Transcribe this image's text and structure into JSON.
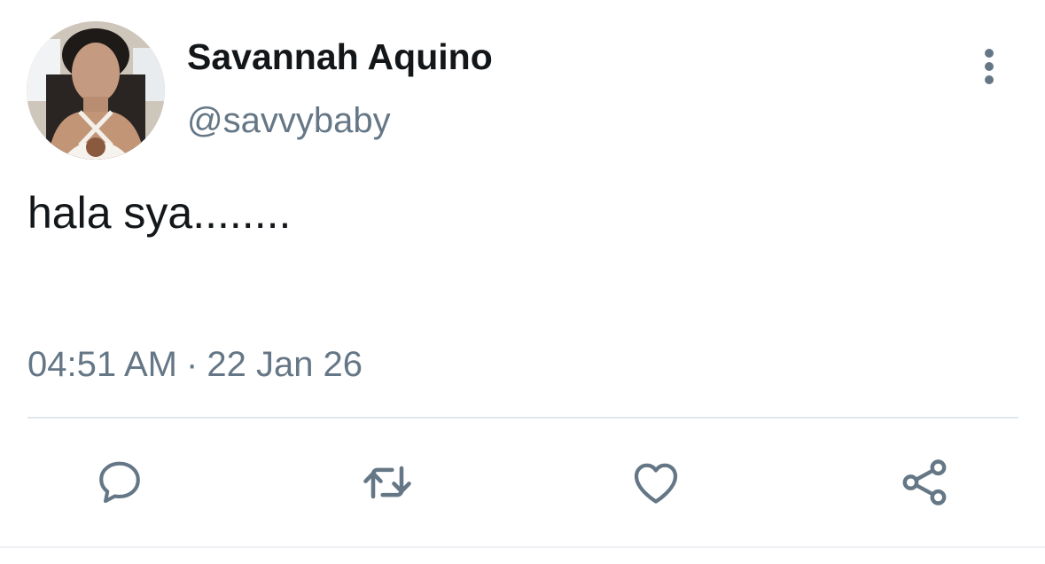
{
  "tweet": {
    "author": {
      "display_name": "Savannah Aquino",
      "handle": "@savvybaby",
      "avatar_icon": "profile-photo"
    },
    "text": "hala sya........",
    "time": "04:51 AM",
    "separator": "·",
    "date": "22 Jan 26"
  },
  "actions": {
    "more_icon": "vertical-ellipsis-icon",
    "reply_icon": "speech-bubble-icon",
    "retweet_icon": "retweet-arrows-icon",
    "like_icon": "heart-icon",
    "share_icon": "share-nodes-icon"
  },
  "colors": {
    "text_primary": "#14171a",
    "text_secondary": "#657786",
    "divider": "#e1e8ed",
    "background": "#ffffff"
  }
}
